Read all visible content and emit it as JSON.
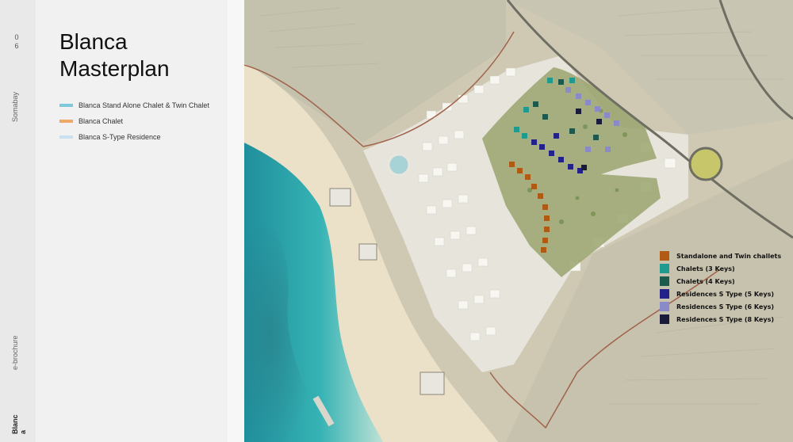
{
  "sidebar": {
    "page_number": "0\n6",
    "brand": "Somabay",
    "section": "e-brochure",
    "current": "Blanc\na"
  },
  "header": {
    "title": "Blanca\nMasterplan"
  },
  "legend_left": [
    {
      "label": "Blanca Stand Alone Chalet & Twin Chalet",
      "color": "#7ec8dc"
    },
    {
      "label": "Blanca Chalet",
      "color": "#f0a868"
    },
    {
      "label": "Blanca S-Type Residence",
      "color": "#c9e1ee"
    }
  ],
  "map_legend": [
    {
      "label": "Standalone and Twin challets",
      "color": "#b05a12"
    },
    {
      "label": "Chalets (3 Keys)",
      "color": "#1f9a8e"
    },
    {
      "label": "Chalets (4 Keys)",
      "color": "#1d5a4e"
    },
    {
      "label": "Residences S Type (5 Keys)",
      "color": "#22228a"
    },
    {
      "label": "Residences S Type (6 Keys)",
      "color": "#8a8ac8"
    },
    {
      "label": "Residences S Type (8 Keys)",
      "color": "#1a1a3a"
    }
  ]
}
